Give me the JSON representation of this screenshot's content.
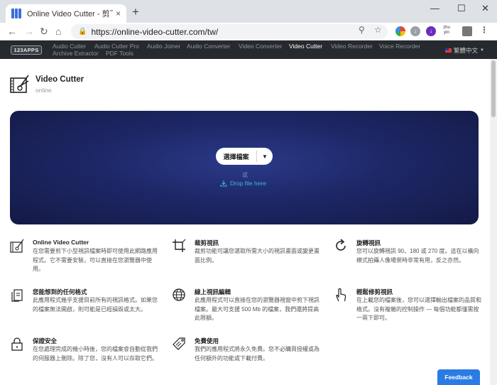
{
  "browser": {
    "tab_title": "Online Video Cutter - 剪下視訊",
    "tab_close": "×",
    "new_tab": "+",
    "url": "https://online-video-cutter.com/tw/",
    "minimize": "—",
    "maximize": "☐",
    "close": "✕",
    "ext_label": "zhu yin"
  },
  "site_nav": {
    "brand": "123APPS",
    "links": [
      "Audio Cutter",
      "Audio Cutter Pro",
      "Audio Joiner",
      "Audio Converter",
      "Video Converter",
      "Video Cutter",
      "Video Recorder",
      "Voice Recorder",
      "Archive Extractor",
      "PDF Tools"
    ],
    "active": "Video Cutter",
    "language": "繁體中文"
  },
  "header": {
    "title": "Video Cutter",
    "subtitle": "online"
  },
  "hero": {
    "choose_label": "選擇檔案",
    "or_text": "或",
    "drop_text": "Drop file here"
  },
  "features": [
    {
      "title": "Online Video Cutter",
      "desc": "在您需要剪下小型視訊檔案時即可使用此網路應用程式。它不需要安裝，可以直接在您瀏覽器中使用。",
      "icon": "video-cutter-icon"
    },
    {
      "title": "裁剪視訊",
      "desc": "裁剪功能可讓您選取所需大小的視訊畫面或變更畫面比例。",
      "icon": "crop-icon"
    },
    {
      "title": "旋轉視訊",
      "desc": "您可以旋轉視訊 90、180 或 270 度。這在以橫向模式拍攝人像場景時非常有用，反之亦然。",
      "icon": "rotate-icon"
    },
    {
      "title": "您能想到的任何格式",
      "desc": "此應用程式幾乎支援目前所有的視訊格式。如果您的檔案無法開啟，則可能是已經損毀或太大。",
      "icon": "files-icon"
    },
    {
      "title": "線上視訊編輯",
      "desc": "此應用程式可以直接在您的瀏覽器視窗中剪下視訊檔案。最大可支援 500 Mb 的檔案，我們還將提高此限額。",
      "icon": "globe-icon"
    },
    {
      "title": "輕鬆修剪視訊",
      "desc": "在上載您的檔案後，您可以選擇輸出檔案的品質和格式。沒有複雜的控制操作 — 每個功能都僅需按一兩下即可。",
      "icon": "touch-icon"
    },
    {
      "title": "保證安全",
      "desc": "在您處理完成的幾小時後，您的檔案會自動從我們的伺服器上刪除。除了您，沒有人可以存取它們。",
      "icon": "lock-icon"
    },
    {
      "title": "免費使用",
      "desc": "我們的應用程式將永久免費。您不必購買授權或為任何額外的功能或下載付費。",
      "icon": "free-tag-icon"
    }
  ],
  "feedback": "Feedback",
  "colors": {
    "nav_bg": "#262a2e",
    "hero_bg": "#1d2766",
    "drop_link": "#41b8c9",
    "feedback_bg": "#2b7be4"
  }
}
